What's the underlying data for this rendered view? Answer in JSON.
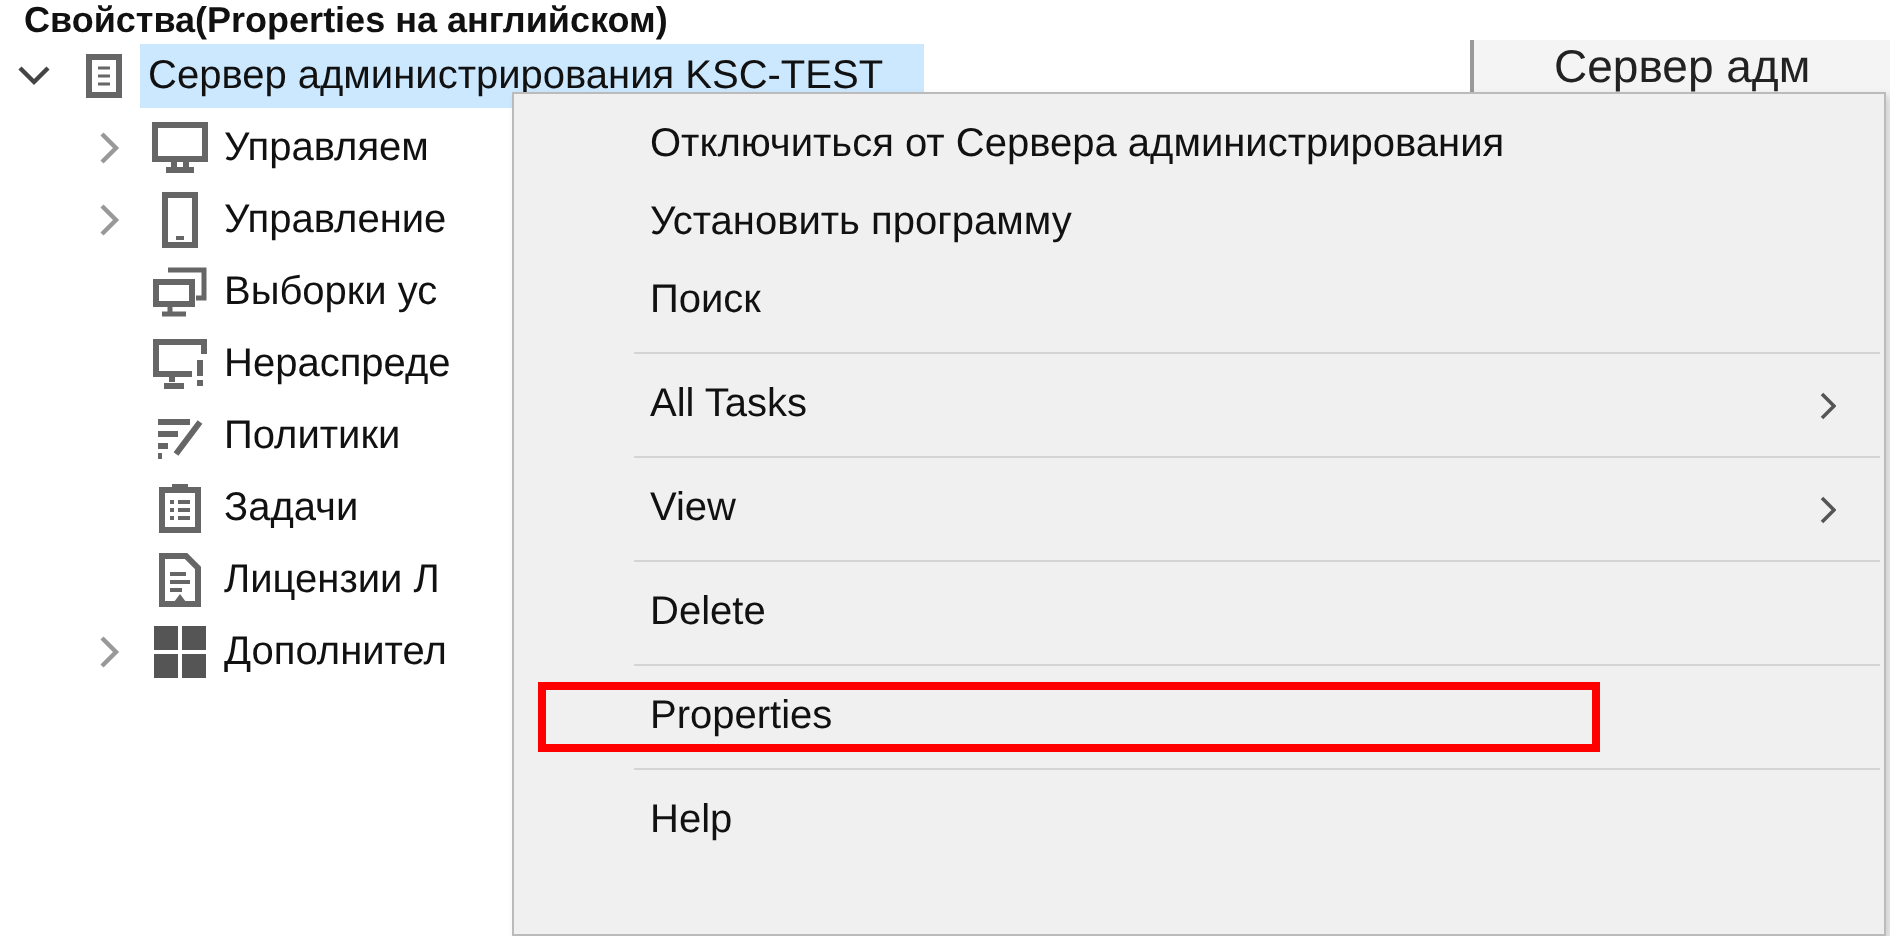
{
  "caption": "Свойства(Properties на английском)",
  "tree": {
    "label": "Сервер администрирования KSC-TEST",
    "kind": "server",
    "expandable": true,
    "expanded": true,
    "selected": true,
    "children": [
      {
        "label": "Управляем",
        "kind": "monitor",
        "expandable": true,
        "selected": false
      },
      {
        "label": "Управление",
        "kind": "phone",
        "expandable": true,
        "selected": false
      },
      {
        "label": "Выборки ус",
        "kind": "monitors",
        "expandable": false,
        "selected": false
      },
      {
        "label": "Нераспреде",
        "kind": "monitor-alert",
        "expandable": false,
        "selected": false
      },
      {
        "label": "Политики",
        "kind": "policy",
        "expandable": false,
        "selected": false
      },
      {
        "label": "Задачи",
        "kind": "clipboard",
        "expandable": false,
        "selected": false
      },
      {
        "label": "Лицензии Л",
        "kind": "document",
        "expandable": false,
        "selected": false
      },
      {
        "label": "Дополнител",
        "kind": "tiles",
        "expandable": true,
        "selected": false
      }
    ]
  },
  "detail": {
    "title": "Сервер адм"
  },
  "context_menu": {
    "groups": [
      [
        {
          "label": "Отключиться от Сервера администрирования",
          "submenu": false,
          "highlighted": false
        },
        {
          "label": "Установить программу",
          "submenu": false,
          "highlighted": false
        },
        {
          "label": "Поиск",
          "submenu": false,
          "highlighted": false
        }
      ],
      [
        {
          "label": "All Tasks",
          "submenu": true,
          "highlighted": false
        }
      ],
      [
        {
          "label": "View",
          "submenu": true,
          "highlighted": false
        }
      ],
      [
        {
          "label": "Delete",
          "submenu": false,
          "highlighted": false
        }
      ],
      [
        {
          "label": "Properties",
          "submenu": false,
          "highlighted": true
        }
      ],
      [
        {
          "label": "Help",
          "submenu": false,
          "highlighted": false
        }
      ]
    ]
  }
}
